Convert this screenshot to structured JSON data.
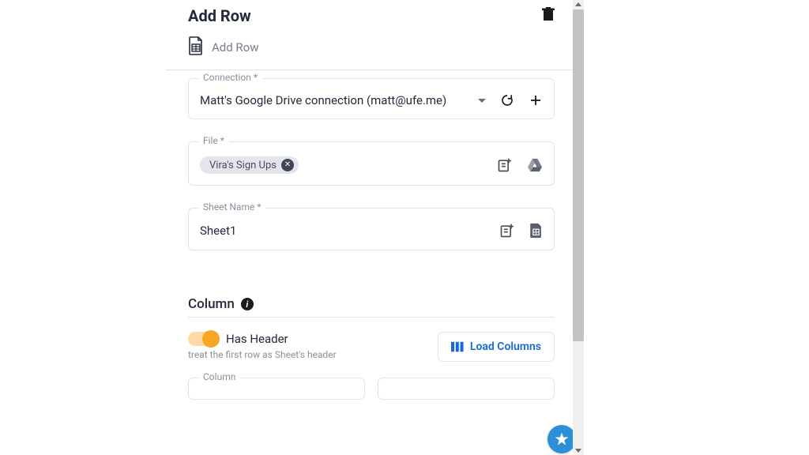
{
  "header": {
    "title": "Add Row",
    "subtitle": "Add Row"
  },
  "fields": {
    "connection": {
      "label": "Connection *",
      "value": "Matt's Google Drive connection (matt@ufe.me)"
    },
    "file": {
      "label": "File *",
      "chip": "Vira's Sign Ups"
    },
    "sheet": {
      "label": "Sheet Name *",
      "value": "Sheet1"
    }
  },
  "section": {
    "column_title": "Column",
    "has_header_label": "Has Header",
    "has_header_desc": "treat the first row as Sheet's header",
    "load_columns_label": "Load Columns",
    "col_stub_label": "Column"
  }
}
